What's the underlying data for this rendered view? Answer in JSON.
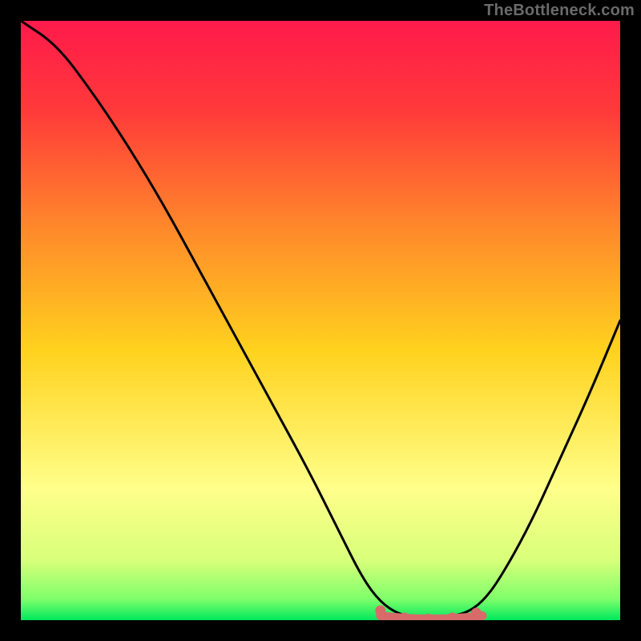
{
  "watermark": "TheBottleneck.com",
  "colors": {
    "gradient_top": "#ff1a4b",
    "gradient_mid": "#ffd21e",
    "gradient_low": "#ffff8a",
    "gradient_bottom": "#00e85e",
    "curve": "#000000",
    "marker_fill": "#d86a6a",
    "marker_stroke": "#d86a6a"
  },
  "chart_data": {
    "type": "line",
    "title": "",
    "xlabel": "",
    "ylabel": "",
    "x_range": [
      0,
      100
    ],
    "y_range": [
      0,
      100
    ],
    "curve": [
      {
        "x": 0,
        "y": 100
      },
      {
        "x": 6,
        "y": 96
      },
      {
        "x": 12,
        "y": 88
      },
      {
        "x": 18,
        "y": 79
      },
      {
        "x": 24,
        "y": 69
      },
      {
        "x": 30,
        "y": 58
      },
      {
        "x": 36,
        "y": 47
      },
      {
        "x": 42,
        "y": 36
      },
      {
        "x": 48,
        "y": 25
      },
      {
        "x": 53,
        "y": 15
      },
      {
        "x": 57,
        "y": 7
      },
      {
        "x": 60,
        "y": 3
      },
      {
        "x": 63,
        "y": 1
      },
      {
        "x": 66,
        "y": 0.5
      },
      {
        "x": 70,
        "y": 0.5
      },
      {
        "x": 74,
        "y": 1
      },
      {
        "x": 77,
        "y": 3
      },
      {
        "x": 80,
        "y": 7
      },
      {
        "x": 85,
        "y": 16
      },
      {
        "x": 90,
        "y": 27
      },
      {
        "x": 95,
        "y": 38
      },
      {
        "x": 100,
        "y": 50
      }
    ],
    "flat_region": {
      "x_start": 60,
      "x_end": 77,
      "y": 1
    },
    "markers": [
      {
        "x": 60,
        "y": 2
      },
      {
        "x": 64,
        "y": 0.8
      },
      {
        "x": 68,
        "y": 0.6
      },
      {
        "x": 72,
        "y": 0.8
      },
      {
        "x": 76,
        "y": 1.6
      }
    ]
  }
}
